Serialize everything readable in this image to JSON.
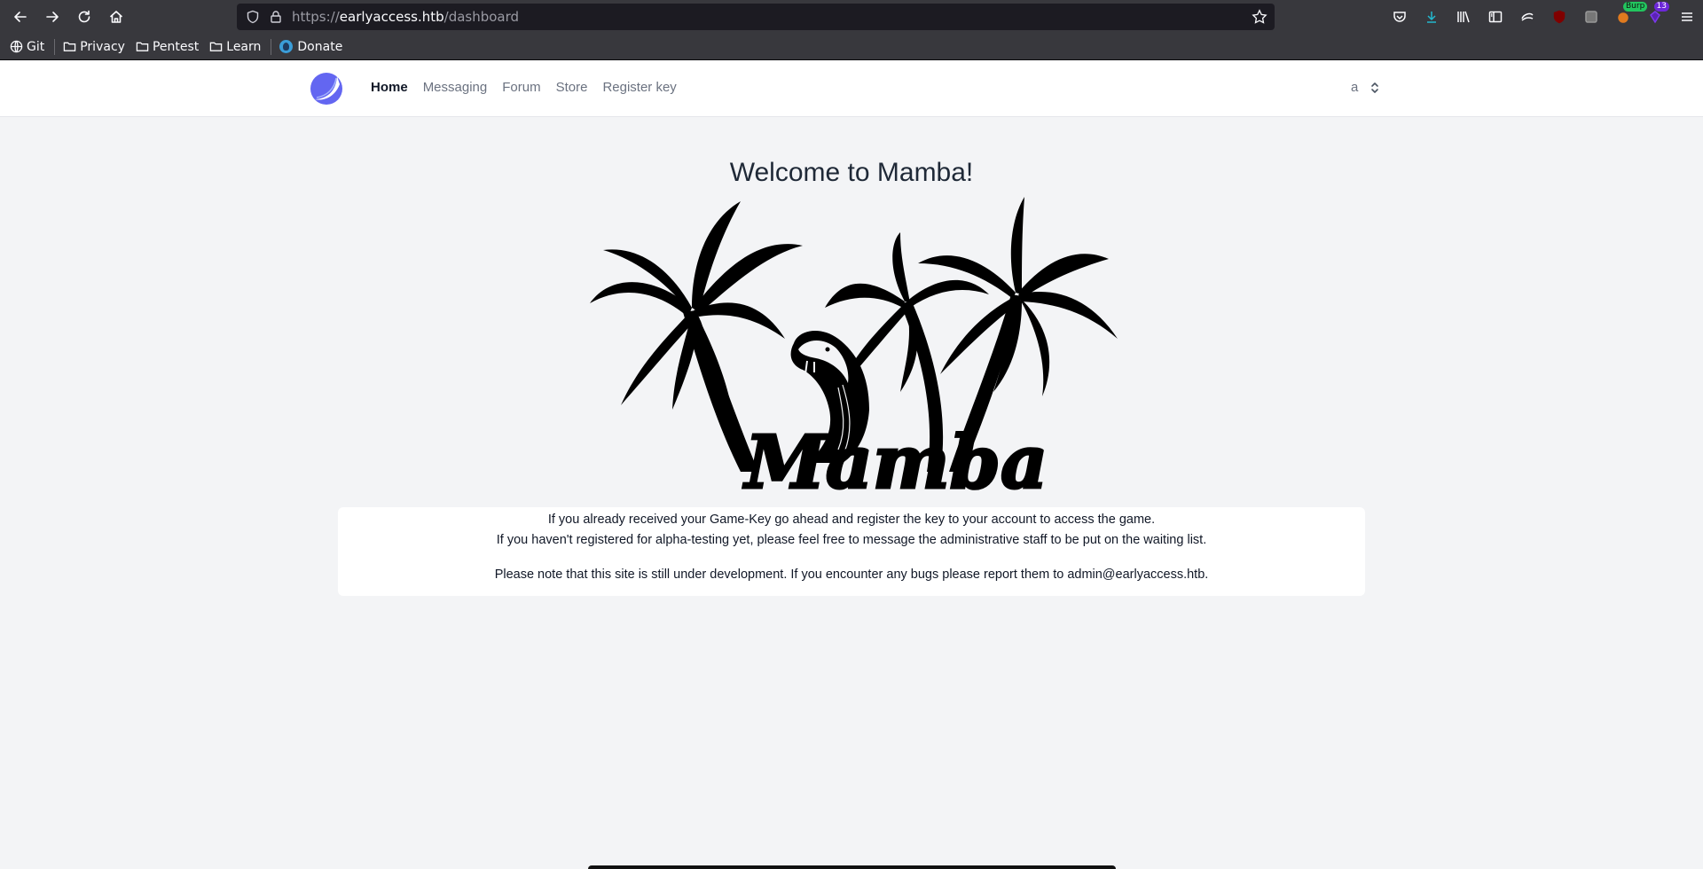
{
  "browser": {
    "url_scheme": "https://",
    "url_host": "earlyaccess.htb",
    "url_path": "/dashboard",
    "bookmarks": [
      {
        "label": "Git",
        "icon": "globe-icon"
      },
      {
        "label": "Privacy",
        "icon": "folder-icon"
      },
      {
        "label": "Pentest",
        "icon": "folder-icon"
      },
      {
        "label": "Learn",
        "icon": "folder-icon"
      },
      {
        "label": "Donate",
        "icon": "donate-icon"
      }
    ],
    "extensions": {
      "burp_label": "Burp",
      "notification_count": "13"
    }
  },
  "site": {
    "nav": {
      "items": [
        {
          "label": "Home",
          "active": true
        },
        {
          "label": "Messaging",
          "active": false
        },
        {
          "label": "Forum",
          "active": false
        },
        {
          "label": "Store",
          "active": false
        },
        {
          "label": "Register key",
          "active": false
        }
      ],
      "user": "a"
    },
    "welcome_title": "Welcome to Mamba!",
    "hero_logo_text": "Mamba",
    "info": {
      "line1": "If you already received your Game-Key go ahead and register the key to your account to access the game.",
      "line2": "If you haven't registered for alpha-testing yet, please feel free to message the administrative staff to be put on the waiting list.",
      "note": "Please note that this site is still under development. If you encounter any bugs please report them to admin@earlyaccess.htb."
    }
  },
  "colors": {
    "chrome_bg": "#38383d",
    "urlbar_bg": "#1c1b22",
    "page_bg": "#f3f4f6",
    "logo_accent": "#6366f1"
  }
}
